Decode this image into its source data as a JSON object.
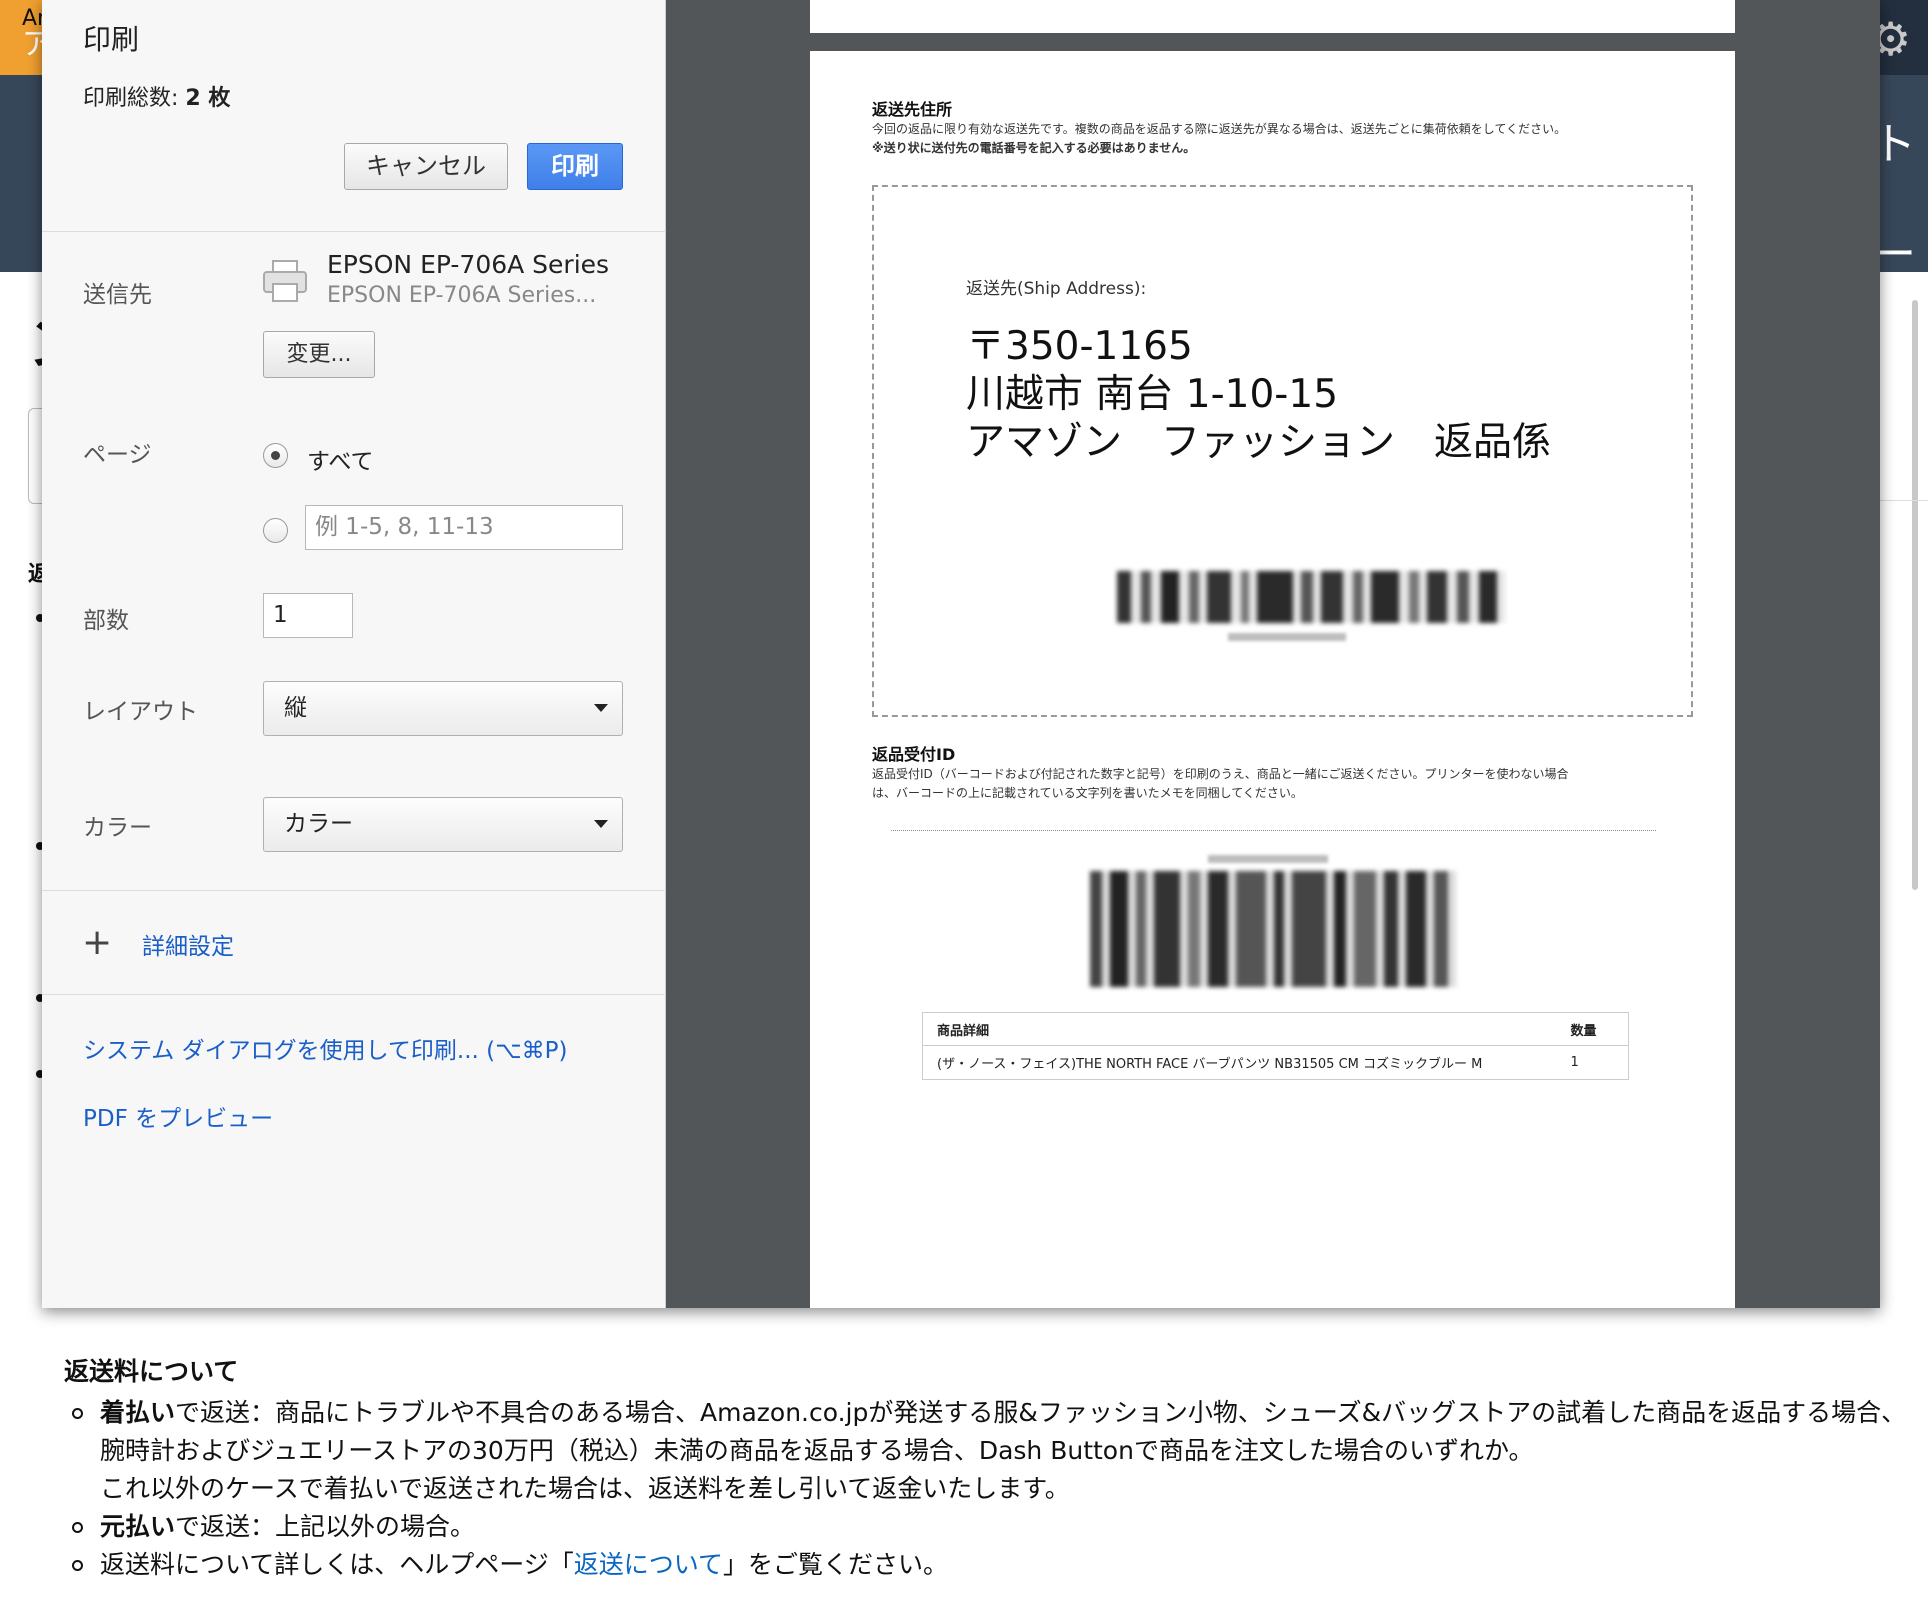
{
  "background_page": {
    "header_logo_text": "Ar",
    "header_logo_sub": "ア",
    "right_fragment_1": "ト",
    "right_fragment_2": "ート",
    "left_glyph": "ン",
    "left_bold_fragment": "返",
    "return_fee": {
      "title": "返送料について",
      "items": [
        {
          "bold": "着払い",
          "text": "で返送：商品にトラブルや不具合のある場合、Amazon.co.jpが発送する服&ファッション小物、シューズ&バッグストアの試着した商品を返品する場合、腕時計およびジュエリーストアの30万円（税込）未満の商品を返品する場合、Dash Buttonで商品を注文した場合のいずれか。",
          "note": "これ以外のケースで着払いで返送された場合は、返送料を差し引いて返金いたします。"
        },
        {
          "bold": "元払い",
          "text": "で返送：上記以外の場合。"
        },
        {
          "prefix": "返送料について詳しくは、ヘルプページ「",
          "link": "返送について",
          "suffix": "」をご覧ください。"
        }
      ]
    }
  },
  "print_dialog": {
    "title": "印刷",
    "total_sheets_label": "印刷総数: ",
    "total_sheets_value": "2 枚",
    "cancel_button": "キャンセル",
    "print_button": "印刷",
    "destination": {
      "label": "送信先",
      "printer_name": "EPSON EP-706A Series",
      "printer_sub": "EPSON EP-706A Series...",
      "change_button": "変更..."
    },
    "pages": {
      "label": "ページ",
      "all_label": "すべて",
      "all_selected": true,
      "range_placeholder": "例 1-5, 8, 11-13"
    },
    "copies": {
      "label": "部数",
      "value": "1"
    },
    "layout": {
      "label": "レイアウト",
      "value": "縦"
    },
    "color": {
      "label": "カラー",
      "value": "カラー"
    },
    "advanced_settings": "詳細設定",
    "system_dialog_link": "システム ダイアログを使用して印刷... (⌥⌘P)",
    "pdf_preview_link": "PDF をプレビュー"
  },
  "preview": {
    "return_address": {
      "heading": "返送先住所",
      "desc1": "今回の返品に限り有効な返送先です。複数の商品を返品する際に返送先が異なる場合は、返送先ごとに集荷依頼をしてください。",
      "desc2": "※送り状に送付先の電話番号を記入する必要はありません。",
      "ship_label": "返送先(Ship Address):",
      "postal": "〒350-1165",
      "address": "川越市 南台 1-10-15",
      "recipient": "アマゾン　ファッション　返品係"
    },
    "return_id": {
      "heading": "返品受付ID",
      "desc1": "返品受付ID（バーコードおよび付記された数字と記号）を印刷のうえ、商品と一緒にご返送ください。プリンターを使わない場合",
      "desc2": "は、バーコードの上に記載されている文字列を書いたメモを同梱してください。"
    },
    "items_table": {
      "headers": [
        "商品詳細",
        "数量"
      ],
      "rows": [
        [
          "(ザ・ノース・フェイス)THE NORTH FACE バーブパンツ NB31505 CM コズミックブルー M",
          "1"
        ]
      ]
    }
  },
  "colors": {
    "primary_button": "#4688f1",
    "link": "#1a5fc8",
    "preview_background": "#525659",
    "top_bar": "#232f3e",
    "nav_band": "#37475a"
  }
}
